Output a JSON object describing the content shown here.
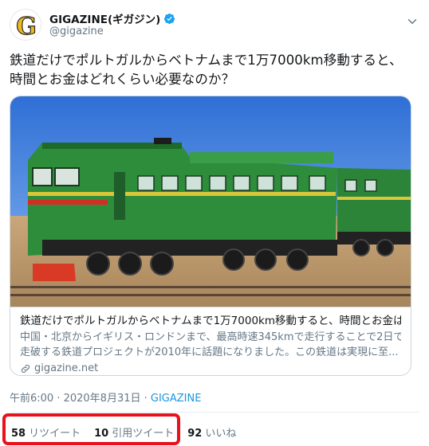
{
  "tweet": {
    "display_name": "GIGAZINE(ギガジン)",
    "handle": "@gigazine",
    "avatar_letter": "G",
    "text_line1": "鉄道だけでポルトガルからベトナムまで1万7000km移動すると、",
    "text_line2": "時間とお金はどれくらい必要なのか？",
    "timestamp": "午前6:00 · 2020年8月31日 · ",
    "source": "GIGAZINE"
  },
  "card": {
    "title": "鉄道だけでポルトガルからベトナムまで1万7000km移動すると、時間とお金は...",
    "desc_line1": "中国・北京からイギリス・ロンドンまで、最高時速345kmで走行することで2日で",
    "desc_line2": "走破する鉄道プロジェクトが2010年に話題になりました。この鉄道は実現に至...",
    "domain": "gigazine.net"
  },
  "stats": {
    "retweets_count": "58",
    "retweets_label": "リツイート",
    "quotes_count": "10",
    "quotes_label": "引用ツイート",
    "likes_count": "92",
    "likes_label": "いいね"
  },
  "colors": {
    "verified": "#1da1f2",
    "link": "#1b95e0",
    "highlight": "#e8121c",
    "logo_yellow": "#f0b91d"
  }
}
